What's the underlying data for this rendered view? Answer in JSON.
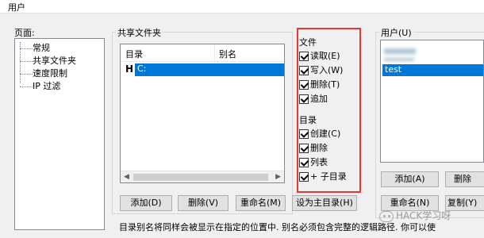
{
  "window": {
    "title": "用户"
  },
  "pages": {
    "label": "页面:",
    "items": [
      "常规",
      "共享文件夹",
      "速度限制",
      "IP 过滤"
    ]
  },
  "shared_folders": {
    "label": "共享文件夹",
    "columns": [
      "目录",
      "别名"
    ],
    "rows": [
      {
        "marker": "H",
        "dir": "C:",
        "alias": ""
      }
    ],
    "buttons": {
      "add": "添加(D)",
      "remove": "删除(V)",
      "rename": "重命名(M)",
      "set_home": "设为主目录(H)"
    }
  },
  "permissions": {
    "files_title": "文件",
    "files": [
      {
        "label": "读取(E)",
        "checked": true
      },
      {
        "label": "写入(W)",
        "checked": true
      },
      {
        "label": "删除(T)",
        "checked": true
      },
      {
        "label": "追加",
        "checked": true
      }
    ],
    "dirs_title": "目录",
    "dirs": [
      {
        "label": "创建(C)",
        "checked": true
      },
      {
        "label": "删除",
        "checked": true
      },
      {
        "label": "列表",
        "checked": true
      },
      {
        "label": "+ 子目录",
        "checked": true
      }
    ],
    "highlight_color": "#e53935"
  },
  "users": {
    "label": "用户(U)",
    "selected": "test",
    "buttons": {
      "add": "添加(A)",
      "remove": "删除",
      "rename": "重命名(N)",
      "copy": "复制(Y)"
    }
  },
  "description": "目录别名将同样会被显示在指定的位置中. 别名必须包含完整的逻辑路径. 你可以使",
  "watermark": "HACK学习呀",
  "colors": {
    "selection": "#0078d7"
  }
}
